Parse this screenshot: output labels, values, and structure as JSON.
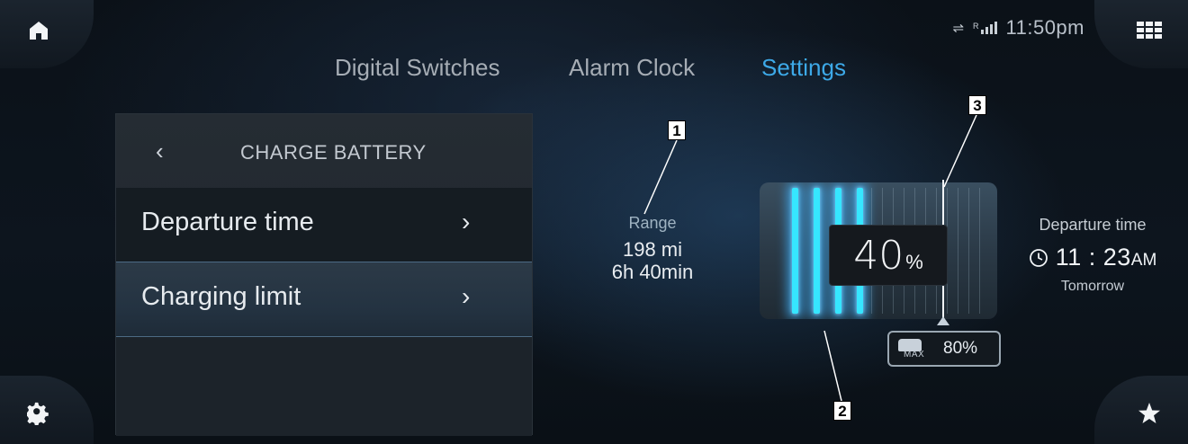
{
  "status_bar": {
    "time": "11:50pm",
    "signal_label": "R",
    "arrows": "⇌"
  },
  "tabs": [
    {
      "label": "Digital Switches",
      "active": false
    },
    {
      "label": "Alarm Clock",
      "active": false
    },
    {
      "label": "Settings",
      "active": true
    }
  ],
  "panel": {
    "back_icon": "chevron-left",
    "title": "CHARGE BATTERY",
    "items": [
      {
        "label": "Departure time",
        "selected": false
      },
      {
        "label": "Charging limit",
        "selected": true
      }
    ]
  },
  "range": {
    "label": "Range",
    "distance": "198 mi",
    "time": "6h 40min"
  },
  "battery": {
    "percent_value": "40",
    "percent_unit": "%",
    "charge_level": 0.4,
    "limit_level": 0.8,
    "max_label": "MAX",
    "max_value": "80%"
  },
  "departure": {
    "label": "Departure time",
    "time": "11 : 23",
    "ampm": "AM",
    "day": "Tomorrow"
  },
  "callouts": [
    "1",
    "2",
    "3"
  ],
  "colors": {
    "accent": "#3da9e8",
    "charge": "#36e6ff"
  },
  "corner_icons": [
    "home-icon",
    "apps-grid-icon",
    "gear-icon",
    "star-icon"
  ]
}
